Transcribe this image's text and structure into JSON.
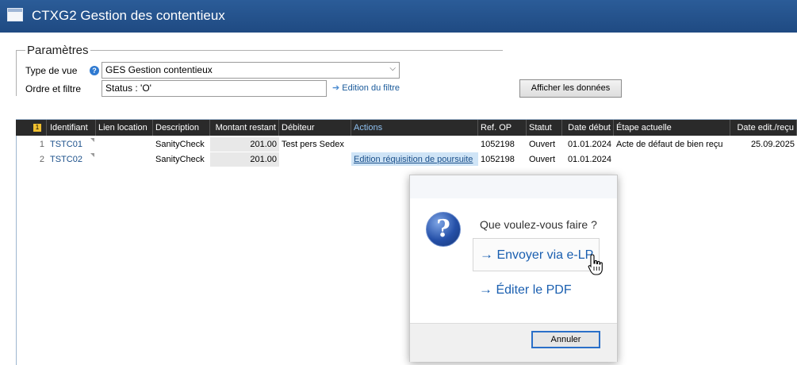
{
  "window": {
    "title": "CTXG2 Gestion des contentieux"
  },
  "params": {
    "legend": "Paramètres",
    "type_label": "Type de vue",
    "type_value": "GES Gestion contentieux",
    "order_label": "Ordre et filtre",
    "order_value": "Status : 'O'",
    "filter_link": "Edition du filtre",
    "show_button": "Afficher les données"
  },
  "grid": {
    "corner_badge": "1",
    "columns": [
      "Identifiant",
      "Lien location",
      "Description",
      "Montant restant",
      "Débiteur",
      "Actions",
      "Ref. OP",
      "Statut",
      "Date début",
      "Étape actuelle",
      "Date edit./reçu"
    ],
    "rows": [
      {
        "num": "1",
        "id": "TSTC01",
        "lien": "",
        "desc": "SanityCheck",
        "montant": "201.00",
        "debiteur": "Test pers Sedex",
        "action": "",
        "ref": "1052198",
        "statut": "Ouvert",
        "date": "01.01.2024",
        "etape": "Acte de défaut de bien reçu",
        "date_edit": "25.09.2025"
      },
      {
        "num": "2",
        "id": "TSTC02",
        "lien": "",
        "desc": "SanityCheck",
        "montant": "201.00",
        "debiteur": "",
        "action": "Edition réquisition de poursuite",
        "ref": "1052198",
        "statut": "Ouvert",
        "date": "01.01.2024",
        "etape": "",
        "date_edit": ""
      }
    ]
  },
  "dialog": {
    "question": "Que voulez-vous faire ?",
    "option1": "Envoyer via e-LP",
    "option2": "Éditer le PDF",
    "cancel": "Annuler",
    "arrow": "→"
  },
  "icons": {
    "help": "help-icon",
    "question": "question-icon",
    "cursor": "hand-cursor-icon"
  }
}
